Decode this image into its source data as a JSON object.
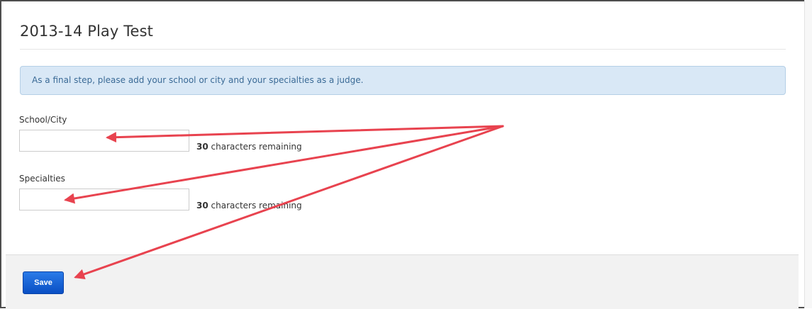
{
  "page": {
    "title": "2013-14 Play Test"
  },
  "alert": {
    "message": "As a final step, please add your school or city and your specialties as a judge."
  },
  "form": {
    "school_city": {
      "label": "School/City",
      "value": "",
      "remaining_count": "30",
      "remaining_text": " characters remaining"
    },
    "specialties": {
      "label": "Specialties",
      "value": "",
      "remaining_count": "30",
      "remaining_text": " characters remaining"
    }
  },
  "footer": {
    "save_label": "Save"
  },
  "colors": {
    "annotation_arrow": "#e8434f",
    "save_button": "#1160d8",
    "alert_background": "#d9e8f6"
  }
}
